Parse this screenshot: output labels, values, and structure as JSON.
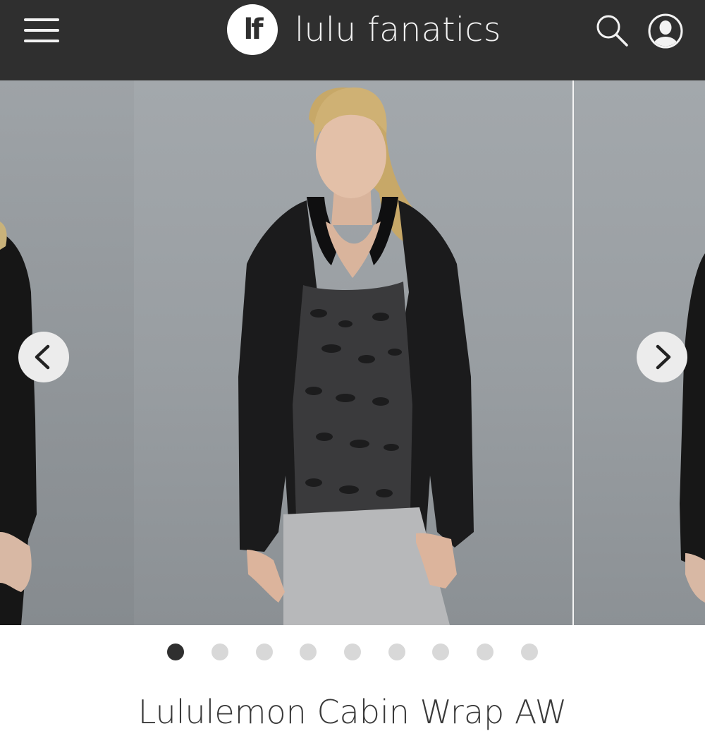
{
  "header": {
    "logo_mark": "lf",
    "brand_name": "lulu fanatics",
    "menu_icon": "hamburger-icon",
    "search_icon": "search-icon",
    "account_icon": "account-icon"
  },
  "carousel": {
    "prev_icon": "chevron-left-icon",
    "next_icon": "chevron-right-icon",
    "slide_count": 9,
    "active_index": 0
  },
  "product": {
    "title": "Lululemon Cabin Wrap AW"
  },
  "colors": {
    "header_bg": "#2f2f2f",
    "dot_active": "#2f2f2f",
    "dot_inactive": "#d8d8d8"
  }
}
